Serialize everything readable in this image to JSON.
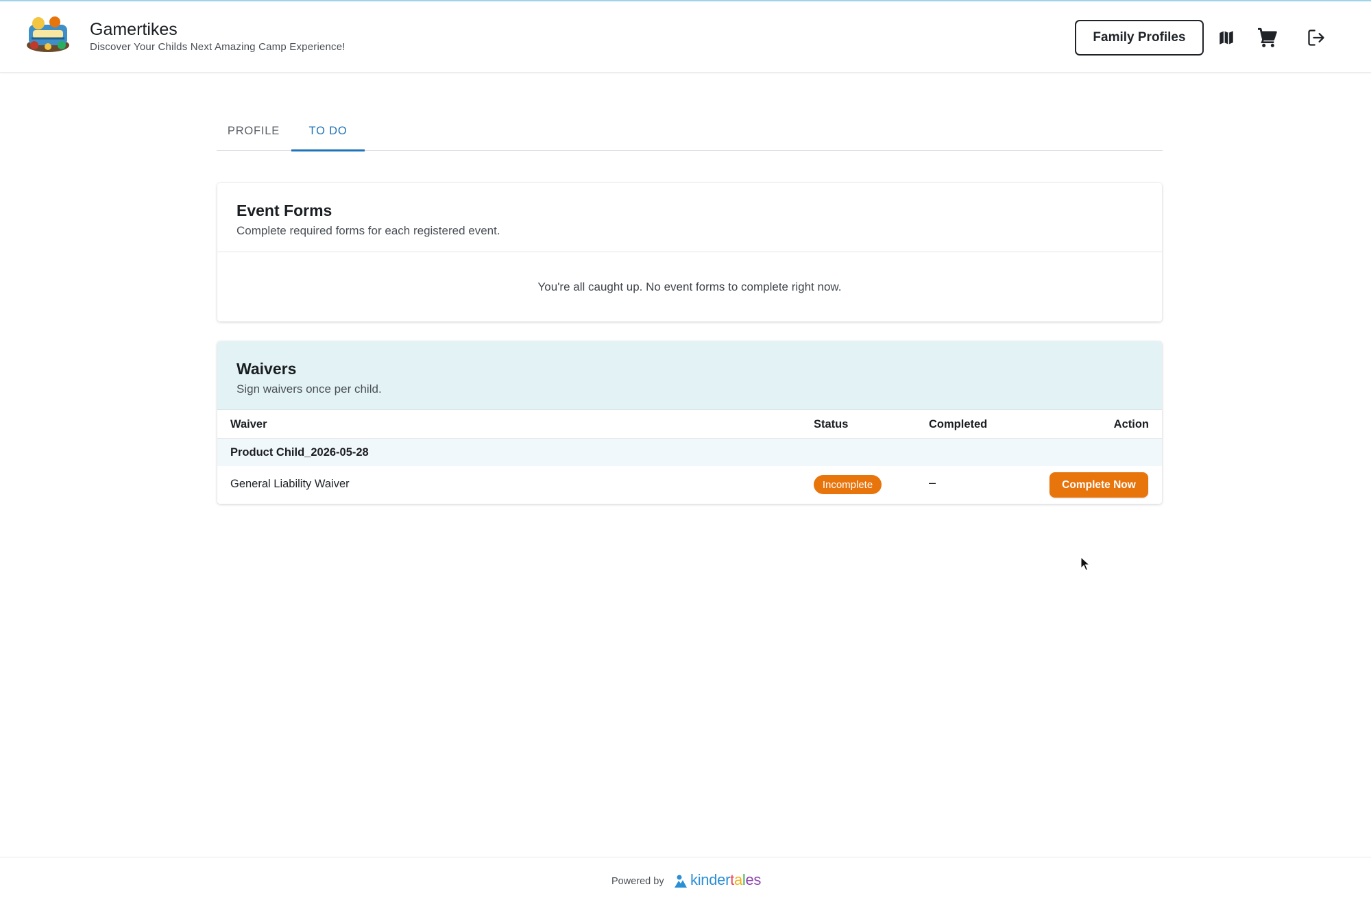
{
  "header": {
    "brand_title": "Gamertikes",
    "brand_tagline": "Discover Your Childs Next Amazing Camp Experience!",
    "family_profiles_label": "Family Profiles",
    "icons": [
      "map-icon",
      "cart-icon",
      "logout-icon"
    ]
  },
  "tabs": [
    {
      "label": "PROFILE",
      "active": false
    },
    {
      "label": "TO DO",
      "active": true
    }
  ],
  "event_forms": {
    "title": "Event Forms",
    "subtitle": "Complete required forms for each registered event.",
    "empty_message": "You're all caught up. No event forms to complete right now."
  },
  "waivers": {
    "title": "Waivers",
    "subtitle": "Sign waivers once per child.",
    "columns": [
      "Waiver",
      "Status",
      "Completed",
      "Action"
    ],
    "groups": [
      {
        "child": "Product Child_2026-05-28",
        "rows": [
          {
            "waiver": "General Liability Waiver",
            "status": "Incomplete",
            "completed": "–",
            "action": "Complete Now"
          }
        ]
      }
    ]
  },
  "footer": {
    "powered_by": "Powered by",
    "brand": "kindertales"
  },
  "colors": {
    "accent_blue": "#1f73b7",
    "status_orange": "#e8740c",
    "waivers_header_bg": "#e3f3f5"
  }
}
